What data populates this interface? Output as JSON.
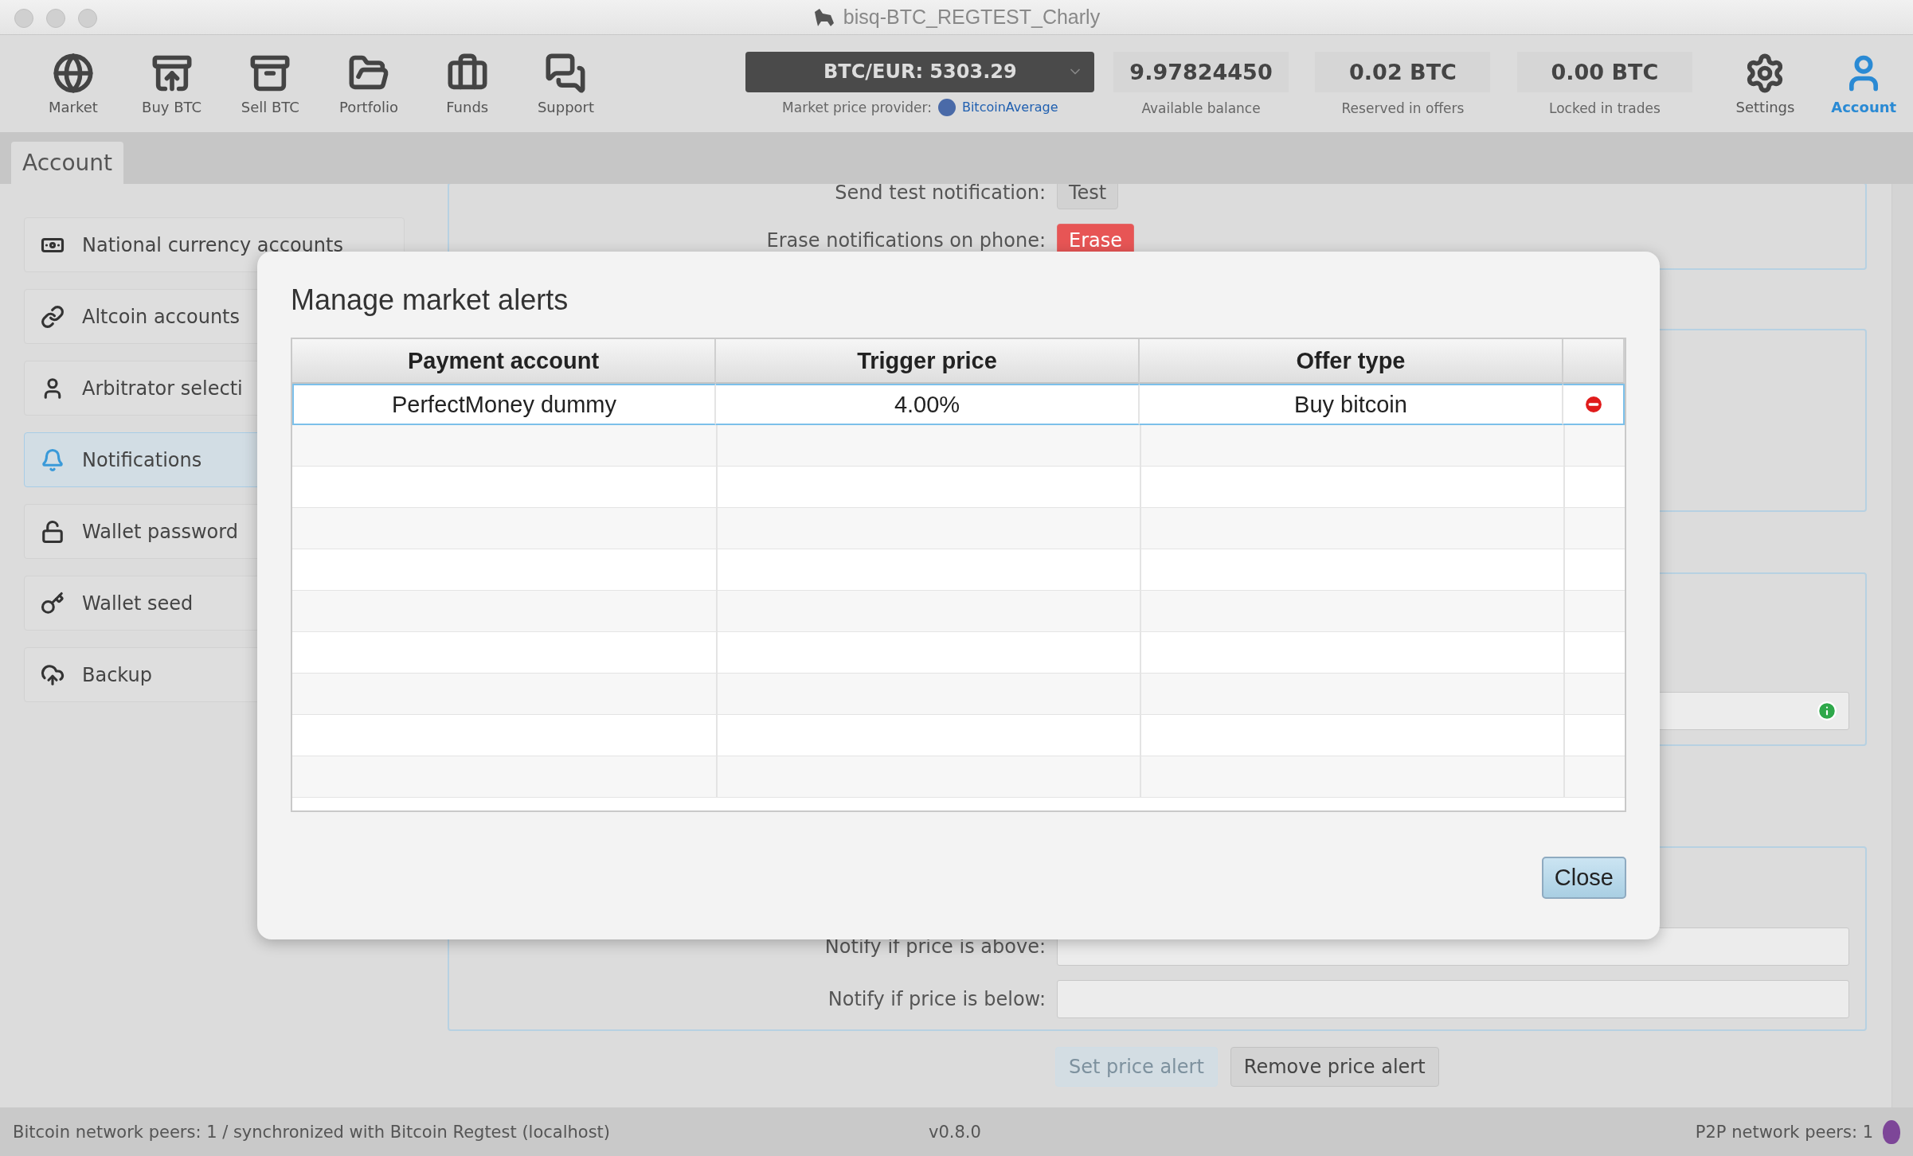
{
  "window": {
    "title": "bisq-BTC_REGTEST_Charly"
  },
  "toolbar": {
    "nav": [
      {
        "label": "Market",
        "selected": false
      },
      {
        "label": "Buy BTC",
        "selected": false
      },
      {
        "label": "Sell BTC",
        "selected": false
      },
      {
        "label": "Portfolio",
        "selected": false
      },
      {
        "label": "Funds",
        "selected": false
      },
      {
        "label": "Support",
        "selected": false
      }
    ],
    "price": {
      "pair": "BTC/EUR: 5303.29",
      "provider_label": "Market price provider:",
      "provider": "BitcoinAverage"
    },
    "balances": [
      {
        "value": "9.97824450",
        "label": "Available balance"
      },
      {
        "value": "0.02 BTC",
        "label": "Reserved in offers"
      },
      {
        "value": "0.00 BTC",
        "label": "Locked in trades"
      }
    ],
    "right": [
      {
        "label": "Settings",
        "selected": false
      },
      {
        "label": "Account",
        "selected": true
      }
    ]
  },
  "tabs": [
    {
      "label": "Account",
      "selected": true
    }
  ],
  "sidebar": {
    "items": [
      {
        "label": "National currency accounts",
        "selected": false
      },
      {
        "label": "Altcoin accounts",
        "selected": false
      },
      {
        "label": "Arbitrator selecti",
        "selected": false
      },
      {
        "label": "Notifications",
        "selected": true
      },
      {
        "label": "Wallet password",
        "selected": false
      },
      {
        "label": "Wallet seed",
        "selected": false
      },
      {
        "label": "Backup",
        "selected": false
      }
    ]
  },
  "notifications_form": {
    "test_label": "Send test notification:",
    "test_button": "Test",
    "erase_label": "Erase notifications on phone:",
    "erase_button": "Erase",
    "above_label": "Notify if price is above:",
    "below_label": "Notify if price is below:",
    "buttons": [
      {
        "label": "Set price alert",
        "disabled": true
      },
      {
        "label": "Remove price alert",
        "disabled": false
      }
    ]
  },
  "dialog": {
    "title": "Manage market alerts",
    "columns": [
      "Payment account",
      "Trigger price",
      "Offer type"
    ],
    "rows": [
      {
        "cells": [
          "PerfectMoney dummy",
          "4.00%",
          "Buy bitcoin"
        ],
        "selected": true
      }
    ],
    "close_button": "Close"
  },
  "status_bar": {
    "left": "Bitcoin network peers: 1 / synchronized with Bitcoin Regtest (localhost)",
    "version": "v0.8.0",
    "right": "P2P network peers: 1"
  }
}
